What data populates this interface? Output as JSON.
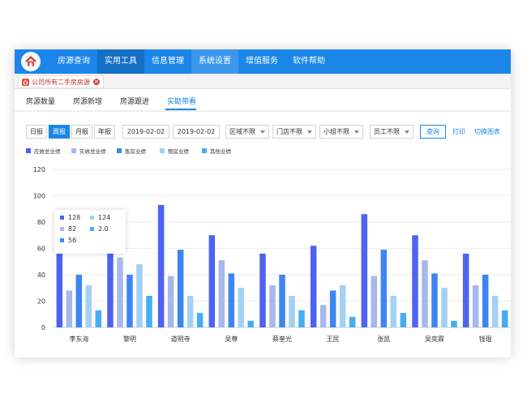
{
  "menu": [
    {
      "label": "房源查询",
      "state": "normal"
    },
    {
      "label": "实用工具",
      "state": "active"
    },
    {
      "label": "信息管理",
      "state": "normal"
    },
    {
      "label": "系统设置",
      "state": "alt"
    },
    {
      "label": "增值服务",
      "state": "normal"
    },
    {
      "label": "软件帮助",
      "state": "normal"
    }
  ],
  "doc_tab": {
    "label": "公司所有二手房房源"
  },
  "subtabs": [
    {
      "label": "房源数量",
      "active": false
    },
    {
      "label": "房源新增",
      "active": false
    },
    {
      "label": "房源跟进",
      "active": false
    },
    {
      "label": "实勘带看",
      "active": true
    }
  ],
  "filters": {
    "periods": [
      {
        "label": "日报",
        "active": false
      },
      {
        "label": "周报",
        "active": true
      },
      {
        "label": "月报",
        "active": false
      },
      {
        "label": "年报",
        "active": false
      }
    ],
    "date_from": "2019-02-02",
    "date_to": "2019-02-02",
    "selects": [
      "区域不限",
      "门店不限",
      "小组不限",
      "员工不限"
    ],
    "query_label": "查询",
    "print_label": "打印",
    "switch_label": "切换图表"
  },
  "colors": {
    "accent": "#1b86e8",
    "series": [
      "#4e63f0",
      "#a7b8ec",
      "#3d86f2",
      "#a3d1f5",
      "#45aef0"
    ]
  },
  "chart_data": {
    "type": "bar",
    "categories": [
      "李东海",
      "黎明",
      "道明寺",
      "吴尊",
      "蔡奎光",
      "王民",
      "张凯",
      "吴奕霖",
      "钱琨"
    ],
    "series": [
      {
        "name": "应收总业绩",
        "values": [
          56,
          83,
          93,
          70,
          56,
          62,
          86,
          70,
          56
        ]
      },
      {
        "name": "实收总业绩",
        "values": [
          28,
          53,
          39,
          51,
          32,
          17,
          39,
          51,
          32
        ]
      },
      {
        "name": "售房业绩",
        "values": [
          40,
          40,
          59,
          41,
          40,
          28,
          59,
          41,
          40
        ]
      },
      {
        "name": "租房业绩",
        "values": [
          32,
          48,
          24,
          30,
          24,
          32,
          24,
          30,
          24
        ]
      },
      {
        "name": "其他业绩",
        "values": [
          13,
          24,
          11,
          5,
          13,
          8,
          11,
          5,
          13
        ]
      }
    ],
    "yticks": [
      0,
      20,
      40,
      60,
      80,
      100,
      120
    ],
    "ylim": [
      0,
      120
    ],
    "legend_position": "top-left",
    "grid": true
  },
  "tooltip": {
    "items": [
      {
        "value": "128",
        "color_index": 0
      },
      {
        "value": "124",
        "color_index": 3
      },
      {
        "value": "82",
        "color_index": 1
      },
      {
        "value": "2.0",
        "color_index": 4
      },
      {
        "value": "56",
        "color_index": 2
      }
    ]
  }
}
